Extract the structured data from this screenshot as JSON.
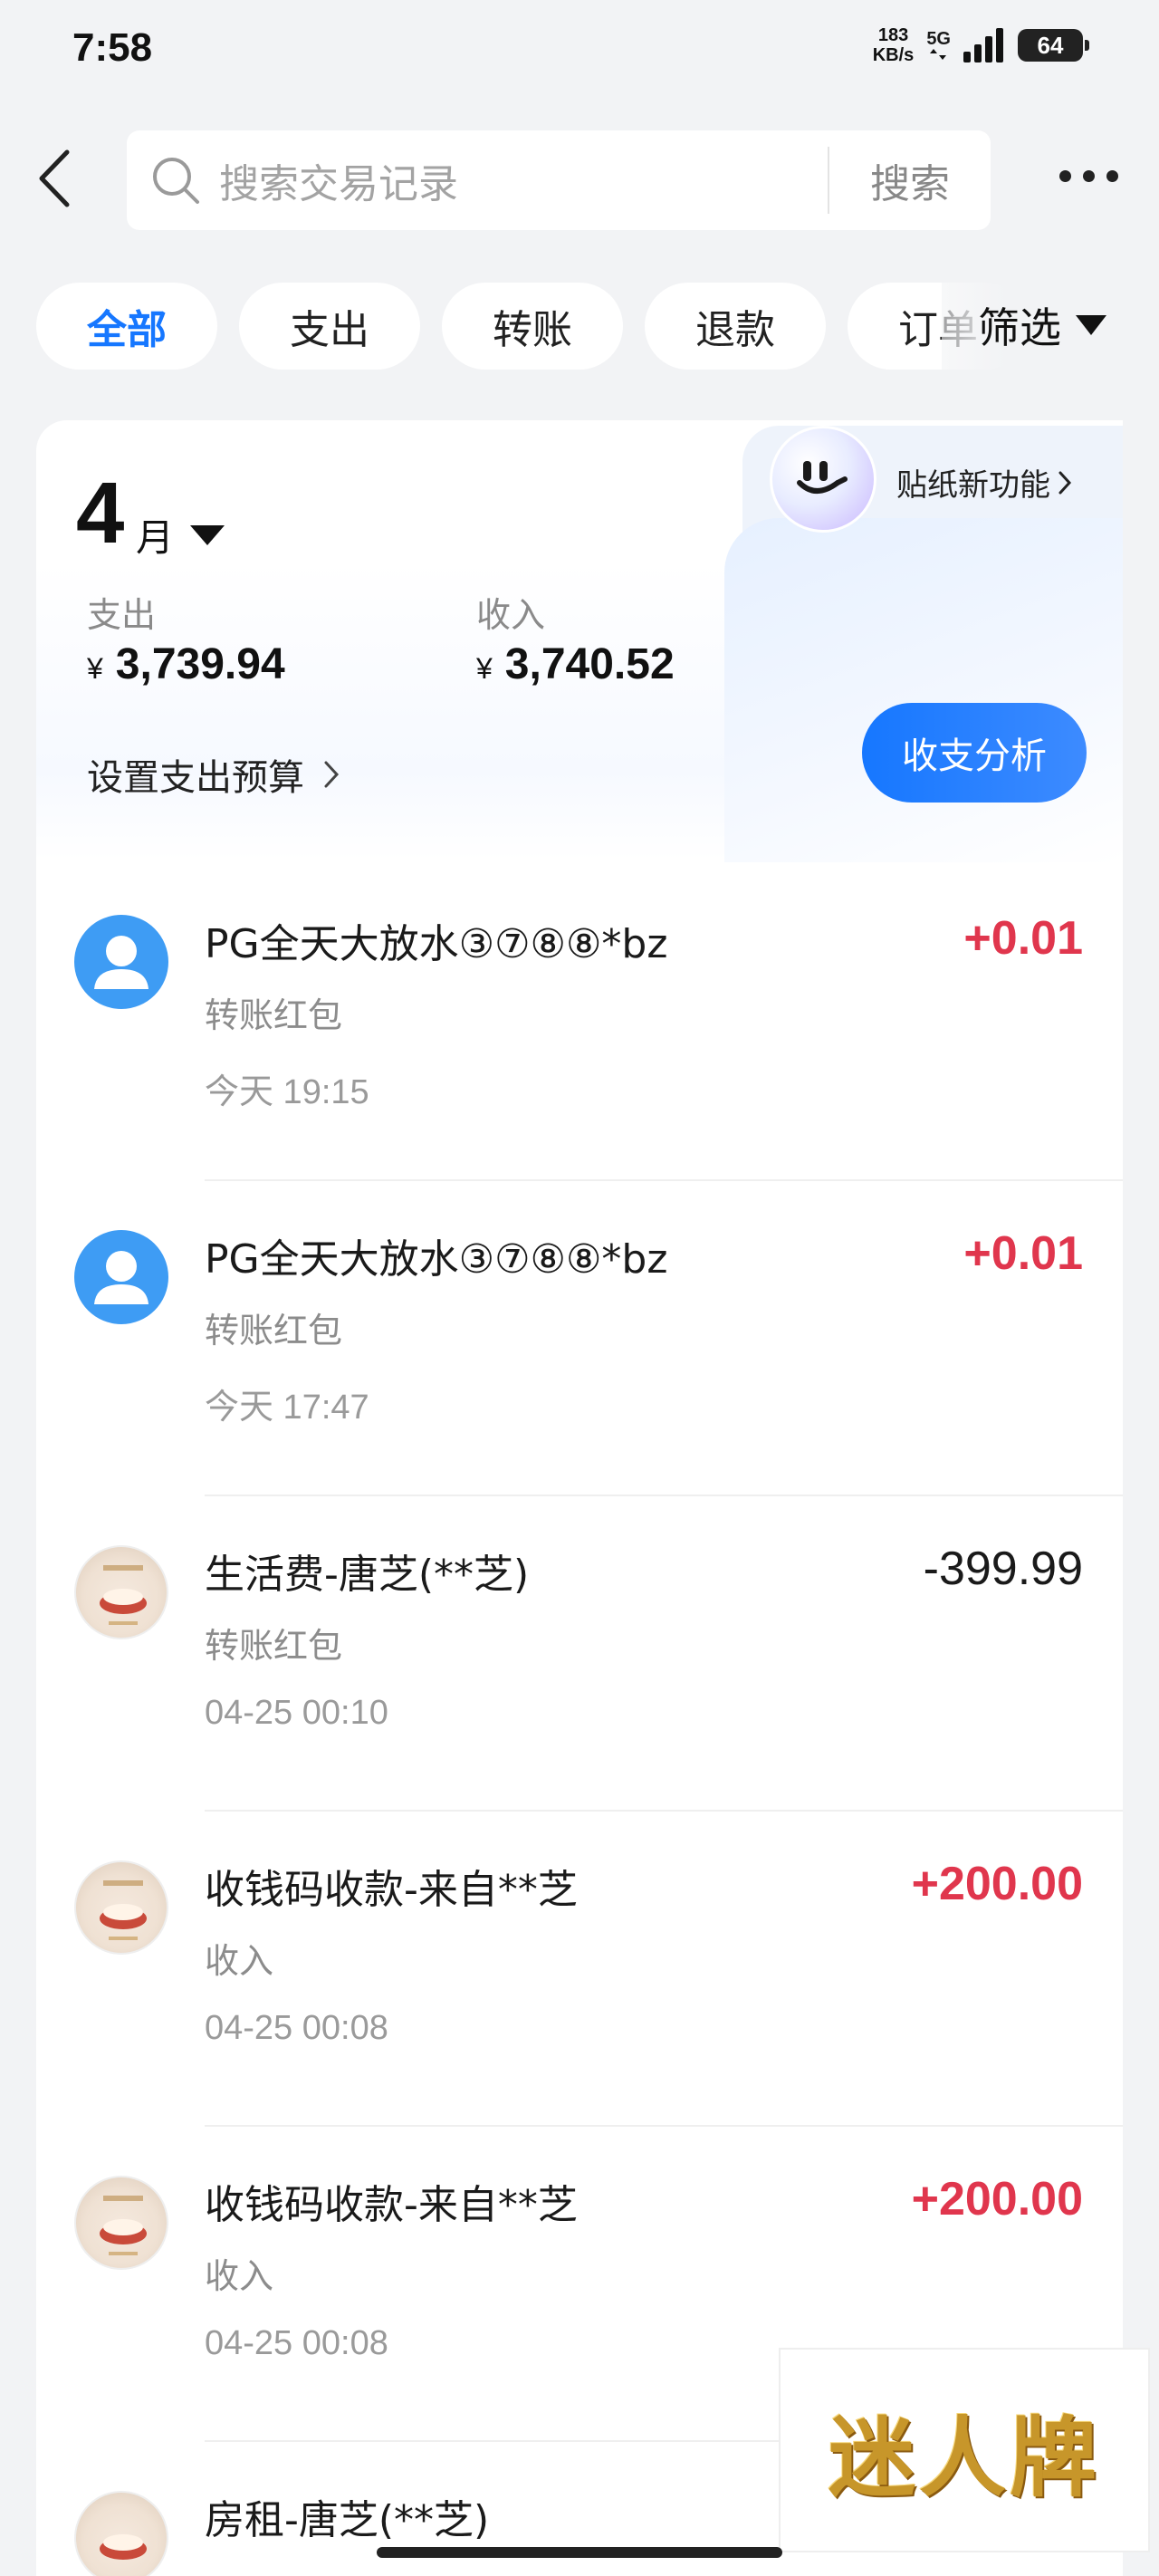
{
  "status_bar": {
    "time": "7:58",
    "net_speed": "183",
    "net_unit": "KB/s",
    "net_type": "5G",
    "battery": "64"
  },
  "header": {
    "search_placeholder": "搜索交易记录",
    "search_button": "搜索"
  },
  "filters": {
    "items": [
      "全部",
      "支出",
      "转账",
      "退款",
      "订单"
    ],
    "active": "全部",
    "screen_label": "筛选"
  },
  "summary": {
    "month_num": "4",
    "month_unit": "月",
    "sticker_label": "贴纸新功能",
    "expense_label": "支出",
    "expense_amount": "3,739.94",
    "income_label": "收入",
    "income_amount": "3,740.52",
    "currency": "¥",
    "budget_label": "设置支出预算",
    "analysis_label": "收支分析"
  },
  "transactions": [
    {
      "title": "PG全天大放水③⑦⑧⑧*bz",
      "sub": "转账红包",
      "time": "今天 19:15",
      "amount": "+0.01",
      "avatar": "person-icon"
    },
    {
      "title": "PG全天大放水③⑦⑧⑧*bz",
      "sub": "转账红包",
      "time": "今天 17:47",
      "amount": "+0.01",
      "avatar": "person-icon"
    },
    {
      "title": "生活费-唐芝(**芝)",
      "sub": "转账红包",
      "time": "04-25 00:10",
      "amount": "-399.99",
      "avatar": "photo-avatar"
    },
    {
      "title": "收钱码收款-来自**芝",
      "sub": "收入",
      "time": "04-25 00:08",
      "amount": "+200.00",
      "avatar": "photo-avatar"
    },
    {
      "title": "收钱码收款-来自**芝",
      "sub": "收入",
      "time": "04-25 00:08",
      "amount": "+200.00",
      "avatar": "photo-avatar"
    },
    {
      "title": "房租-唐芝(**芝)",
      "sub": "",
      "time": "",
      "amount": "",
      "avatar": "photo-avatar"
    }
  ],
  "watermark": "迷人牌",
  "colors": {
    "accent": "#1677ff",
    "positive": "#e0364d",
    "avatar_blue": "#3e9cf4"
  }
}
